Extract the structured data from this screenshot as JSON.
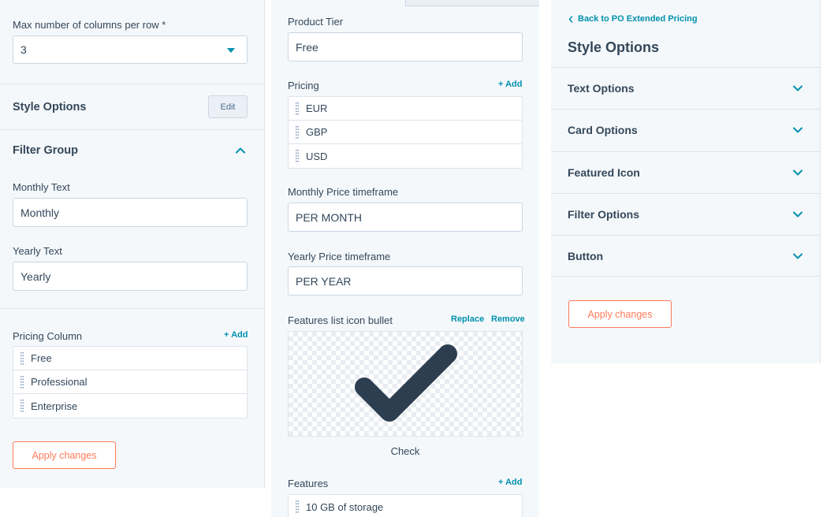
{
  "left": {
    "columns_label": "Max number of columns per row *",
    "columns_value": "3",
    "style_options_title": "Style Options",
    "edit_label": "Edit",
    "filter_group_title": "Filter Group",
    "monthly_label": "Monthly Text",
    "monthly_value": "Monthly",
    "yearly_label": "Yearly Text",
    "yearly_value": "Yearly",
    "pricing_column_label": "Pricing Column",
    "add_label": "+ Add",
    "pricing_columns": [
      "Free",
      "Professional",
      "Enterprise"
    ],
    "apply_label": "Apply changes"
  },
  "middle": {
    "product_tier_label": "Product Tier",
    "product_tier_value": "Free",
    "pricing_label": "Pricing",
    "add_label": "+ Add",
    "currencies": [
      "EUR",
      "GBP",
      "USD"
    ],
    "monthly_tf_label": "Monthly Price timeframe",
    "monthly_tf_value": "PER MONTH",
    "yearly_tf_label": "Yearly Price timeframe",
    "yearly_tf_value": "PER YEAR",
    "icon_bullet_label": "Features list icon bullet",
    "replace_label": "Replace",
    "remove_label": "Remove",
    "icon_name": "Check",
    "features_label": "Features",
    "features_add_label": "+ Add",
    "features": [
      "10 GB of storage"
    ]
  },
  "right": {
    "back_link": "Back to PO Extended Pricing",
    "title": "Style Options",
    "sections": [
      "Text Options",
      "Card Options",
      "Featured Icon",
      "Filter Options",
      "Button"
    ],
    "apply_label": "Apply changes"
  },
  "colors": {
    "accent_teal": "#0091ae",
    "accent_orange": "#ff7a59",
    "text": "#33475b",
    "panel_bg": "#f5f8fa",
    "icon_dark": "#2d3e50"
  }
}
